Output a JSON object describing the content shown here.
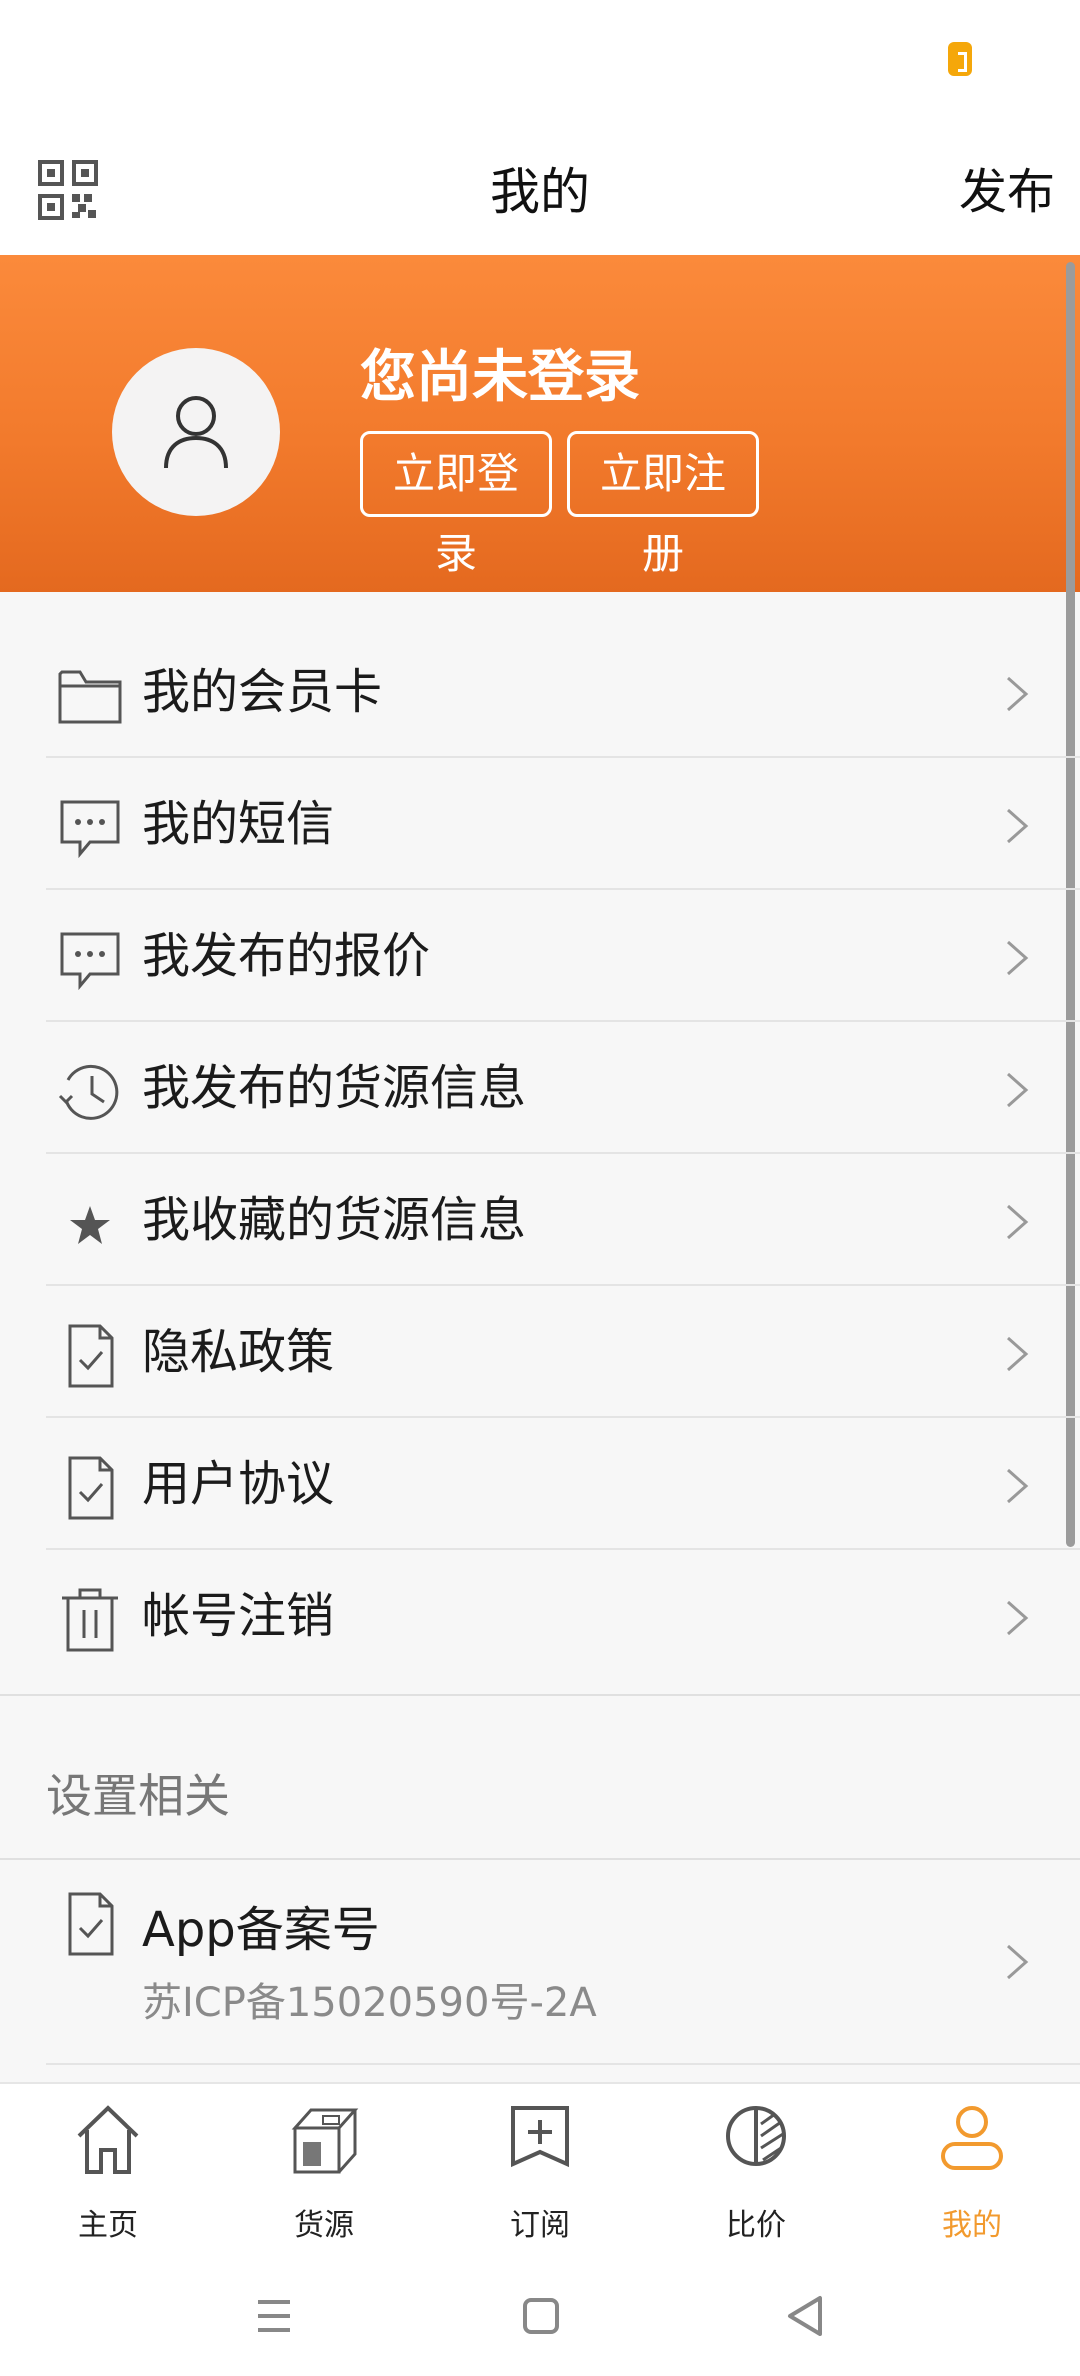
{
  "header": {
    "title": "我的",
    "publish_label": "发布"
  },
  "profile": {
    "status": "您尚未登录",
    "login_label": "立即登录",
    "register_label": "立即注册"
  },
  "menu": [
    {
      "label": "我的会员卡",
      "icon": "folder-icon"
    },
    {
      "label": "我的短信",
      "icon": "message-icon"
    },
    {
      "label": "我发布的报价",
      "icon": "message-icon"
    },
    {
      "label": "我发布的货源信息",
      "icon": "history-icon"
    },
    {
      "label": "我收藏的货源信息",
      "icon": "star-icon"
    },
    {
      "label": "隐私政策",
      "icon": "document-check-icon"
    },
    {
      "label": "用户协议",
      "icon": "document-check-icon"
    },
    {
      "label": "帐号注销",
      "icon": "trash-icon"
    }
  ],
  "settings": {
    "section_title": "设置相关",
    "record_title": "App备案号",
    "record_value": "苏ICP备15020590号-2A"
  },
  "tabbar": {
    "tabs": [
      {
        "label": "主页",
        "icon": "home-icon"
      },
      {
        "label": "货源",
        "icon": "cargo-icon"
      },
      {
        "label": "订阅",
        "icon": "subscribe-icon"
      },
      {
        "label": "比价",
        "icon": "compare-icon"
      },
      {
        "label": "我的",
        "icon": "profile-icon",
        "active": true
      }
    ]
  },
  "colors": {
    "accent": "#f27a2c",
    "active_tab": "#f29a2e",
    "battery": "#f5a70a"
  }
}
